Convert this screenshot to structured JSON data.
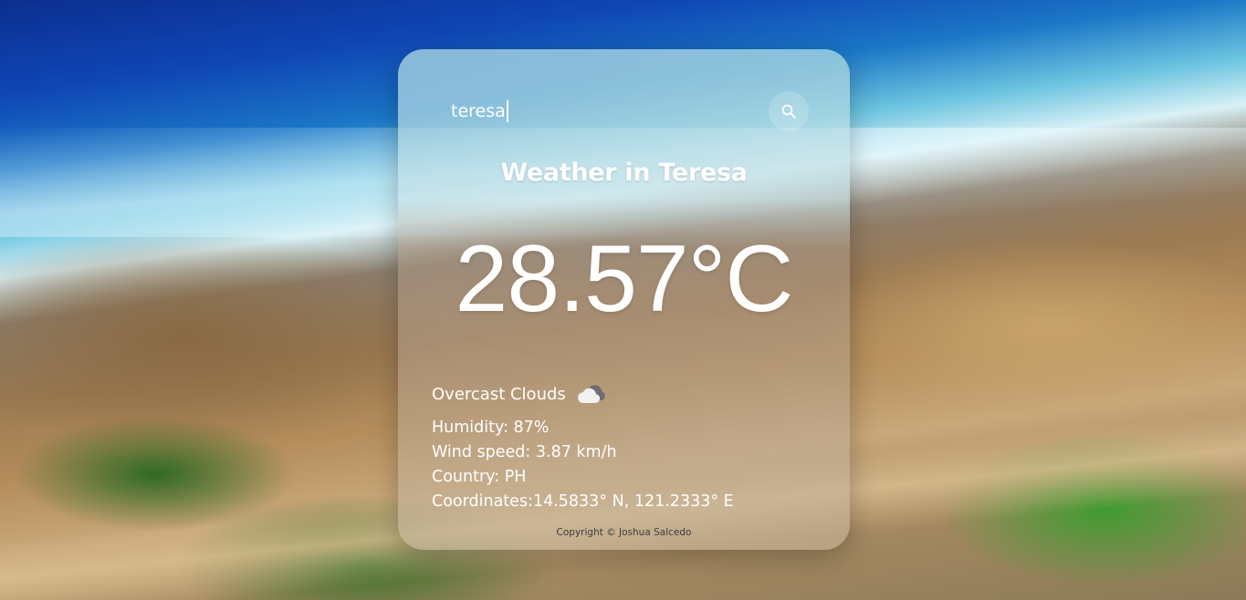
{
  "search": {
    "value": "teresa"
  },
  "weather": {
    "title": "Weather in Teresa",
    "temperature": "28.57°C",
    "description": "Overcast Clouds",
    "icon": "cloud-icon",
    "humidity": "Humidity: 87%",
    "wind": "Wind speed: 3.87 km/h",
    "country": "Country: PH",
    "coordinates": "Coordinates:14.5833° N, 121.2333° E"
  },
  "footer": {
    "copyright": "Copyright © Joshua Salcedo"
  },
  "colors": {
    "text": "#ffffff",
    "footer_text": "#3b3b3b"
  }
}
